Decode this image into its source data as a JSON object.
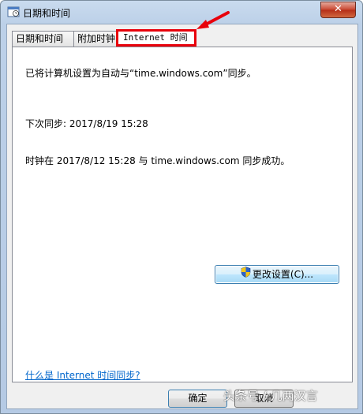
{
  "window": {
    "title": "日期和时间",
    "close_glyph": "✕"
  },
  "tabs": [
    {
      "label": "日期和时间"
    },
    {
      "label": "附加时钟"
    },
    {
      "label": "Internet 时间"
    }
  ],
  "panel": {
    "sync_status": "已将计算机设置为自动与“time.windows.com”同步。",
    "next_sync": "下次同步: 2017/8/19 15:28",
    "last_sync": "时钟在 2017/8/12 15:28 与 time.windows.com 同步成功。",
    "change_button": "更改设置(C)...",
    "help_link": "什么是 Internet 时间同步?"
  },
  "footer": {
    "ok_label": "确定",
    "cancel_label": "取消"
  },
  "watermark": "头条号 / 几两汉言",
  "colors": {
    "highlight": "#e8000b",
    "link": "#0066cc"
  }
}
